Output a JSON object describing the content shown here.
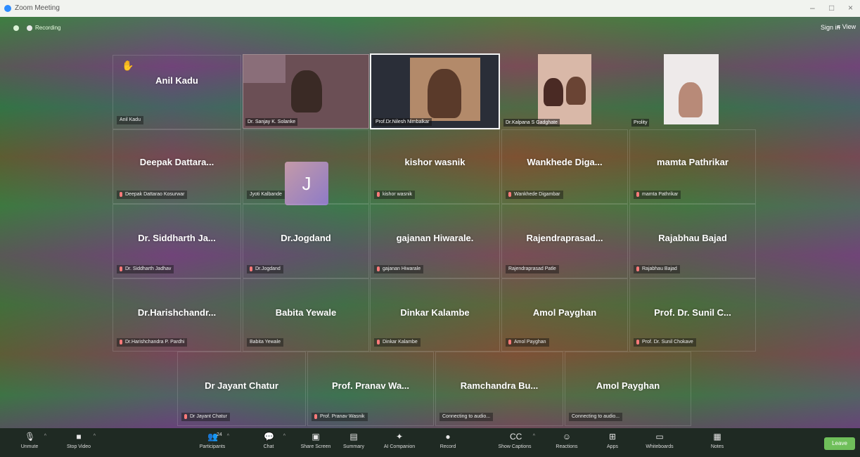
{
  "window": {
    "title": "Zoom Meeting",
    "minimize": "–",
    "maximize": "□",
    "close": "×"
  },
  "topbar": {
    "recording": "Recording",
    "signin": "Sign in",
    "view": "View"
  },
  "video_tiles": [
    {
      "label": "Dr. Sanjay K. Solanke"
    },
    {
      "label": "Prof.Dr.Nilesh Nimbalkar"
    },
    {
      "label": "Dr.Kalpana S Gadghate"
    },
    {
      "label": "Prolity"
    }
  ],
  "avatar_tile": {
    "initial": "J",
    "label": "Jyoti Kalbande"
  },
  "name_tiles": [
    {
      "big": "Anil Kadu",
      "label": "Anil Kadu",
      "muted": false
    },
    {
      "big": "Deepak  Dattara...",
      "label": "Deepak Dattarao Kosurwar",
      "muted": true
    },
    {
      "big": "kishor wasnik",
      "label": "kishor wasnik",
      "muted": true
    },
    {
      "big": "Wankhede  Diga...",
      "label": "Wankhede Digambar",
      "muted": true
    },
    {
      "big": "mamta Pathrikar",
      "label": "mamta Pathrikar",
      "muted": true
    },
    {
      "big": "Dr. Siddharth Ja...",
      "label": "Dr. Siddharth Jadhav",
      "muted": true
    },
    {
      "big": "Dr.Jogdand",
      "label": "Dr.Jogdand",
      "muted": true
    },
    {
      "big": "gajanan Hiwarale.",
      "label": "gajanan Hiwarale",
      "muted": true
    },
    {
      "big": "Rajendraprasad...",
      "label": "Rajendraprasad Patle",
      "muted": false
    },
    {
      "big": "Rajabhau Bajad",
      "label": "Rajabhau Bajad",
      "muted": true
    },
    {
      "big": "Dr.Harishchandr...",
      "label": "Dr.Harishchandra P. Pardhi",
      "muted": true
    },
    {
      "big": "Babita Yewale",
      "label": "Babita Yewale",
      "muted": false
    },
    {
      "big": "Dinkar Kalambe",
      "label": "Dinkar Kalambe",
      "muted": true
    },
    {
      "big": "Amol Payghan",
      "label": "Amol Payghan",
      "muted": true
    },
    {
      "big": "Prof. Dr. Sunil C...",
      "label": "Prof. Dr. Sunil Chokave",
      "muted": true
    },
    {
      "big": "Dr Jayant Chatur",
      "label": "Dr Jayant Chatur",
      "muted": true
    },
    {
      "big": "Prof. Pranav Wa...",
      "label": "Prof. Pranav Wasnik",
      "muted": true
    },
    {
      "big": "Ramchandra  Bu...",
      "label": "Connecting to audio...",
      "muted": false
    },
    {
      "big": "Amol Payghan",
      "label": "Connecting to audio...",
      "muted": false
    }
  ],
  "toolbar": {
    "unmute": "Unmute",
    "stop_video": "Stop Video",
    "participants": "Participants",
    "participants_count": "24",
    "chat": "Chat",
    "share_screen": "Share Screen",
    "summary": "Summary",
    "ai_companion": "AI Companion",
    "record": "Record",
    "show_captions": "Show Captions",
    "reactions": "Reactions",
    "apps": "Apps",
    "whiteboards": "Whiteboards",
    "notes": "Notes",
    "leave": "Leave"
  }
}
